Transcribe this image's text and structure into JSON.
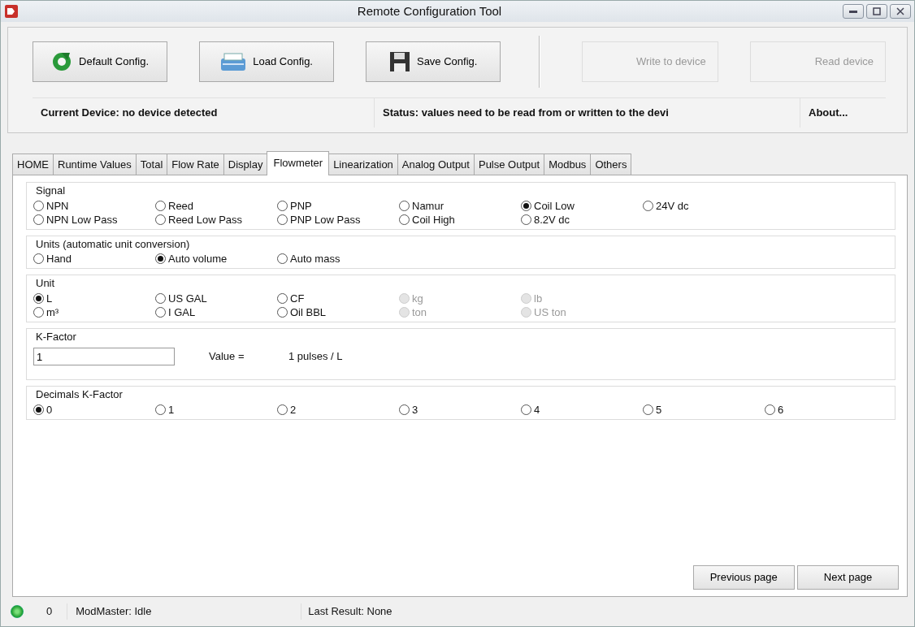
{
  "window": {
    "title": "Remote Configuration Tool"
  },
  "toolbar": {
    "buttons": [
      {
        "label": "Default Config.",
        "disabled": false
      },
      {
        "label": "Load Config.",
        "disabled": false
      },
      {
        "label": "Save Config.",
        "disabled": false
      },
      {
        "label": "Write to device",
        "disabled": true
      },
      {
        "label": "Read device",
        "disabled": true
      }
    ],
    "current_device": "Current Device: no device detected",
    "status": "Status: values need to be read from or written to the devi",
    "about": "About..."
  },
  "tabs": [
    {
      "label": "HOME",
      "selected": false
    },
    {
      "label": "Runtime Values",
      "selected": false
    },
    {
      "label": "Total",
      "selected": false
    },
    {
      "label": "Flow Rate",
      "selected": false
    },
    {
      "label": "Display",
      "selected": false
    },
    {
      "label": "Flowmeter",
      "selected": true
    },
    {
      "label": "Linearization",
      "selected": false
    },
    {
      "label": "Analog Output",
      "selected": false
    },
    {
      "label": "Pulse Output",
      "selected": false
    },
    {
      "label": "Modbus",
      "selected": false
    },
    {
      "label": "Others",
      "selected": false
    }
  ],
  "groups": [
    {
      "kind": "radios",
      "title": "Signal",
      "rows": [
        [
          {
            "label": "NPN",
            "selected": false,
            "disabled": false
          },
          {
            "label": "Reed",
            "selected": false,
            "disabled": false
          },
          {
            "label": "PNP",
            "selected": false,
            "disabled": false
          },
          {
            "label": "Namur",
            "selected": false,
            "disabled": false
          },
          {
            "label": "Coil Low",
            "selected": true,
            "disabled": false
          },
          {
            "label": "24V dc",
            "selected": false,
            "disabled": false
          }
        ],
        [
          {
            "label": "NPN Low Pass",
            "selected": false,
            "disabled": false
          },
          {
            "label": "Reed Low Pass",
            "selected": false,
            "disabled": false
          },
          {
            "label": "PNP Low Pass",
            "selected": false,
            "disabled": false
          },
          {
            "label": "Coil High",
            "selected": false,
            "disabled": false
          },
          {
            "label": "8.2V dc",
            "selected": false,
            "disabled": false
          }
        ]
      ]
    },
    {
      "kind": "radios",
      "title": "Units (automatic unit conversion)",
      "rows": [
        [
          {
            "label": "Hand",
            "selected": false,
            "disabled": false
          },
          {
            "label": "Auto volume",
            "selected": true,
            "disabled": false
          },
          {
            "label": "Auto mass",
            "selected": false,
            "disabled": false
          }
        ]
      ]
    },
    {
      "kind": "radios",
      "title": "Unit",
      "rows": [
        [
          {
            "label": "L",
            "selected": true,
            "disabled": false
          },
          {
            "label": "US GAL",
            "selected": false,
            "disabled": false
          },
          {
            "label": "CF",
            "selected": false,
            "disabled": false
          },
          {
            "label": "kg",
            "selected": false,
            "disabled": true
          },
          {
            "label": "lb",
            "selected": false,
            "disabled": true
          }
        ],
        [
          {
            "label": "m³",
            "selected": false,
            "disabled": false
          },
          {
            "label": "I GAL",
            "selected": false,
            "disabled": false
          },
          {
            "label": "Oil BBL",
            "selected": false,
            "disabled": false
          },
          {
            "label": "ton",
            "selected": false,
            "disabled": true
          },
          {
            "label": "US ton",
            "selected": false,
            "disabled": true
          }
        ]
      ]
    },
    {
      "kind": "kfactor",
      "title": "K-Factor",
      "value": "1",
      "value_label": "Value =",
      "result": "1 pulses / L"
    },
    {
      "kind": "radios",
      "title": "Decimals K-Factor",
      "rows": [
        [
          {
            "label": "0",
            "selected": true,
            "disabled": false
          },
          {
            "label": "1",
            "selected": false,
            "disabled": false
          },
          {
            "label": "2",
            "selected": false,
            "disabled": false
          },
          {
            "label": "3",
            "selected": false,
            "disabled": false
          },
          {
            "label": "4",
            "selected": false,
            "disabled": false
          },
          {
            "label": "5",
            "selected": false,
            "disabled": false
          },
          {
            "label": "6",
            "selected": false,
            "disabled": false
          }
        ]
      ]
    }
  ],
  "nav_buttons": [
    "Previous page",
    "Next page"
  ],
  "status_bar": {
    "led_on": true,
    "count": "0",
    "modmaster": "ModMaster: Idle",
    "last_result": "Last Result: None"
  }
}
